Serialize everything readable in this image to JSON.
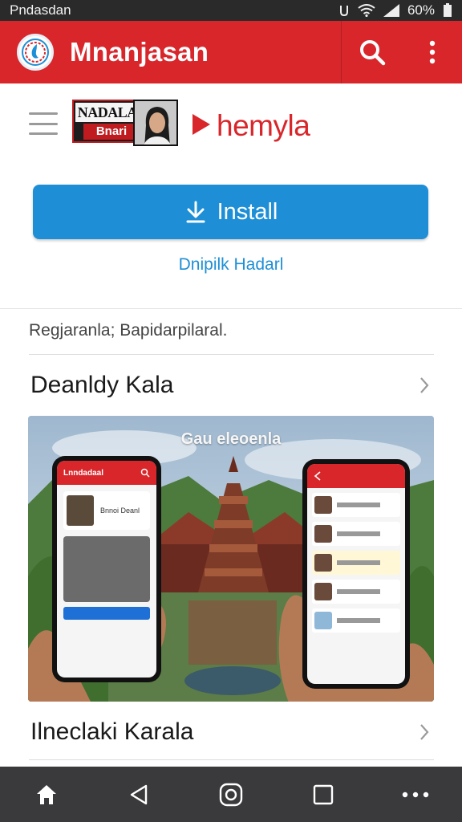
{
  "status_bar": {
    "carrier": "Pndasdan",
    "battery": "60%"
  },
  "app_bar": {
    "title": "Mnanjasan"
  },
  "header": {
    "channel_logo_top": "NADALAI",
    "channel_logo_bottom": "Bnari",
    "brand": "hemyla"
  },
  "install": {
    "label": "Install",
    "secondary_link": "Dnipilk Hadarl"
  },
  "info": {
    "subtitle": "Regjaranla; Bapidarpilaral."
  },
  "sections": [
    {
      "title": "Deanldy Kala"
    },
    {
      "title": "Ilneclaki Karala"
    }
  ],
  "banner": {
    "overlay_text": "Gau eleoenla",
    "left_phone": {
      "header": "Lnndadaal",
      "card_title": "Bnnoi Deanl"
    },
    "right_phone": {
      "header": ""
    }
  },
  "colors": {
    "primary_red": "#d8262b",
    "accent_blue": "#1e8fd6",
    "nav_bg": "#3a3a3c"
  },
  "icons": [
    "home-icon",
    "back-icon",
    "recent-icon",
    "square-icon",
    "more-icon"
  ]
}
